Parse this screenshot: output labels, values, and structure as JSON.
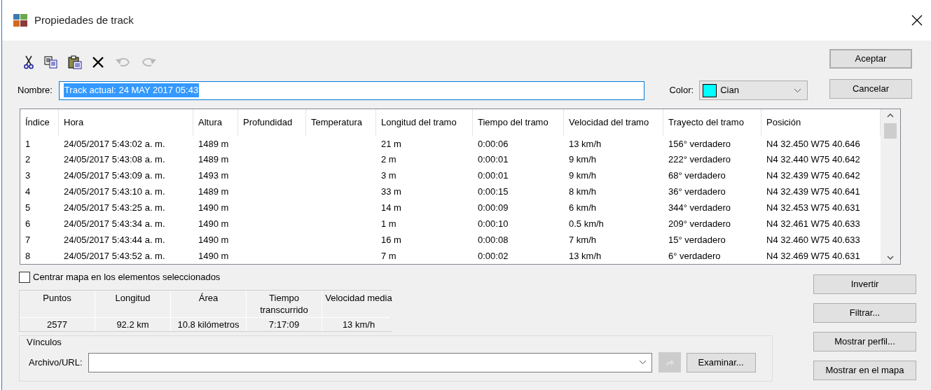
{
  "window": {
    "title": "Propiedades de track"
  },
  "toolbar": [
    {
      "kind": "cut",
      "disabled": false
    },
    {
      "kind": "copy",
      "disabled": false
    },
    {
      "kind": "paste",
      "disabled": false
    },
    {
      "kind": "delete",
      "disabled": false
    },
    {
      "kind": "undo",
      "disabled": true
    },
    {
      "kind": "redo",
      "disabled": true
    }
  ],
  "name": {
    "label": "Nombre:",
    "value": "Track actual: 24 MAY 2017 05:43",
    "selected": true
  },
  "color": {
    "label": "Color:",
    "value": "Cian",
    "color": "#00ffff"
  },
  "dialog_buttons": [
    "Aceptar",
    "Cancelar"
  ],
  "table": {
    "columns": [
      "Índice",
      "Hora",
      "Altura",
      "Profundidad",
      "Temperatura",
      "Longitud del tramo",
      "Tiempo del tramo",
      "Velocidad del tramo",
      "Trayecto del tramo",
      "Posición"
    ],
    "rows": [
      [
        "1",
        "24/05/2017 5:43:02 a. m.",
        "1489 m",
        "",
        "",
        "21 m",
        "0:00:06",
        "13 km/h",
        "156° verdadero",
        "N4 32.450 W75 40.646"
      ],
      [
        "2",
        "24/05/2017 5:43:08 a. m.",
        "1489 m",
        "",
        "",
        "2 m",
        "0:00:01",
        "9 km/h",
        "222° verdadero",
        "N4 32.440 W75 40.642"
      ],
      [
        "3",
        "24/05/2017 5:43:09 a. m.",
        "1493 m",
        "",
        "",
        "3 m",
        "0:00:01",
        "9 km/h",
        "68° verdadero",
        "N4 32.439 W75 40.642"
      ],
      [
        "4",
        "24/05/2017 5:43:10 a. m.",
        "1489 m",
        "",
        "",
        "33 m",
        "0:00:15",
        "8 km/h",
        "36° verdadero",
        "N4 32.439 W75 40.641"
      ],
      [
        "5",
        "24/05/2017 5:43:25 a. m.",
        "1490 m",
        "",
        "",
        "14 m",
        "0:00:09",
        "6 km/h",
        "344° verdadero",
        "N4 32.453 W75 40.631"
      ],
      [
        "6",
        "24/05/2017 5:43:34 a. m.",
        "1490 m",
        "",
        "",
        "1 m",
        "0:00:10",
        "0.5 km/h",
        "209° verdadero",
        "N4 32.461 W75 40.633"
      ],
      [
        "7",
        "24/05/2017 5:43:44 a. m.",
        "1490 m",
        "",
        "",
        "16 m",
        "0:00:08",
        "7 km/h",
        "15° verdadero",
        "N4 32.460 W75 40.633"
      ],
      [
        "8",
        "24/05/2017 5:43:52 a. m.",
        "1490 m",
        "",
        "",
        "7 m",
        "0:00:02",
        "13 km/h",
        "6° verdadero",
        "N4 32.469 W75 40.631"
      ]
    ]
  },
  "center_map": {
    "label": "Centrar mapa en los elementos seleccionados",
    "checked": false
  },
  "stats": {
    "columns": [
      "Puntos",
      "Longitud",
      "Área",
      "Tiempo transcurrido",
      "Velocidad media"
    ],
    "values": [
      "2577",
      "92.2 km",
      "10.8 kilómetros",
      "7:17:09",
      "13 km/h"
    ]
  },
  "links": {
    "title": "Vínculos",
    "label": "Archivo/URL:",
    "browse": "Examinar..."
  },
  "side_buttons": [
    "Invertir",
    "Filtrar...",
    "Mostrar perfil...",
    "Mostrar en el mapa"
  ]
}
